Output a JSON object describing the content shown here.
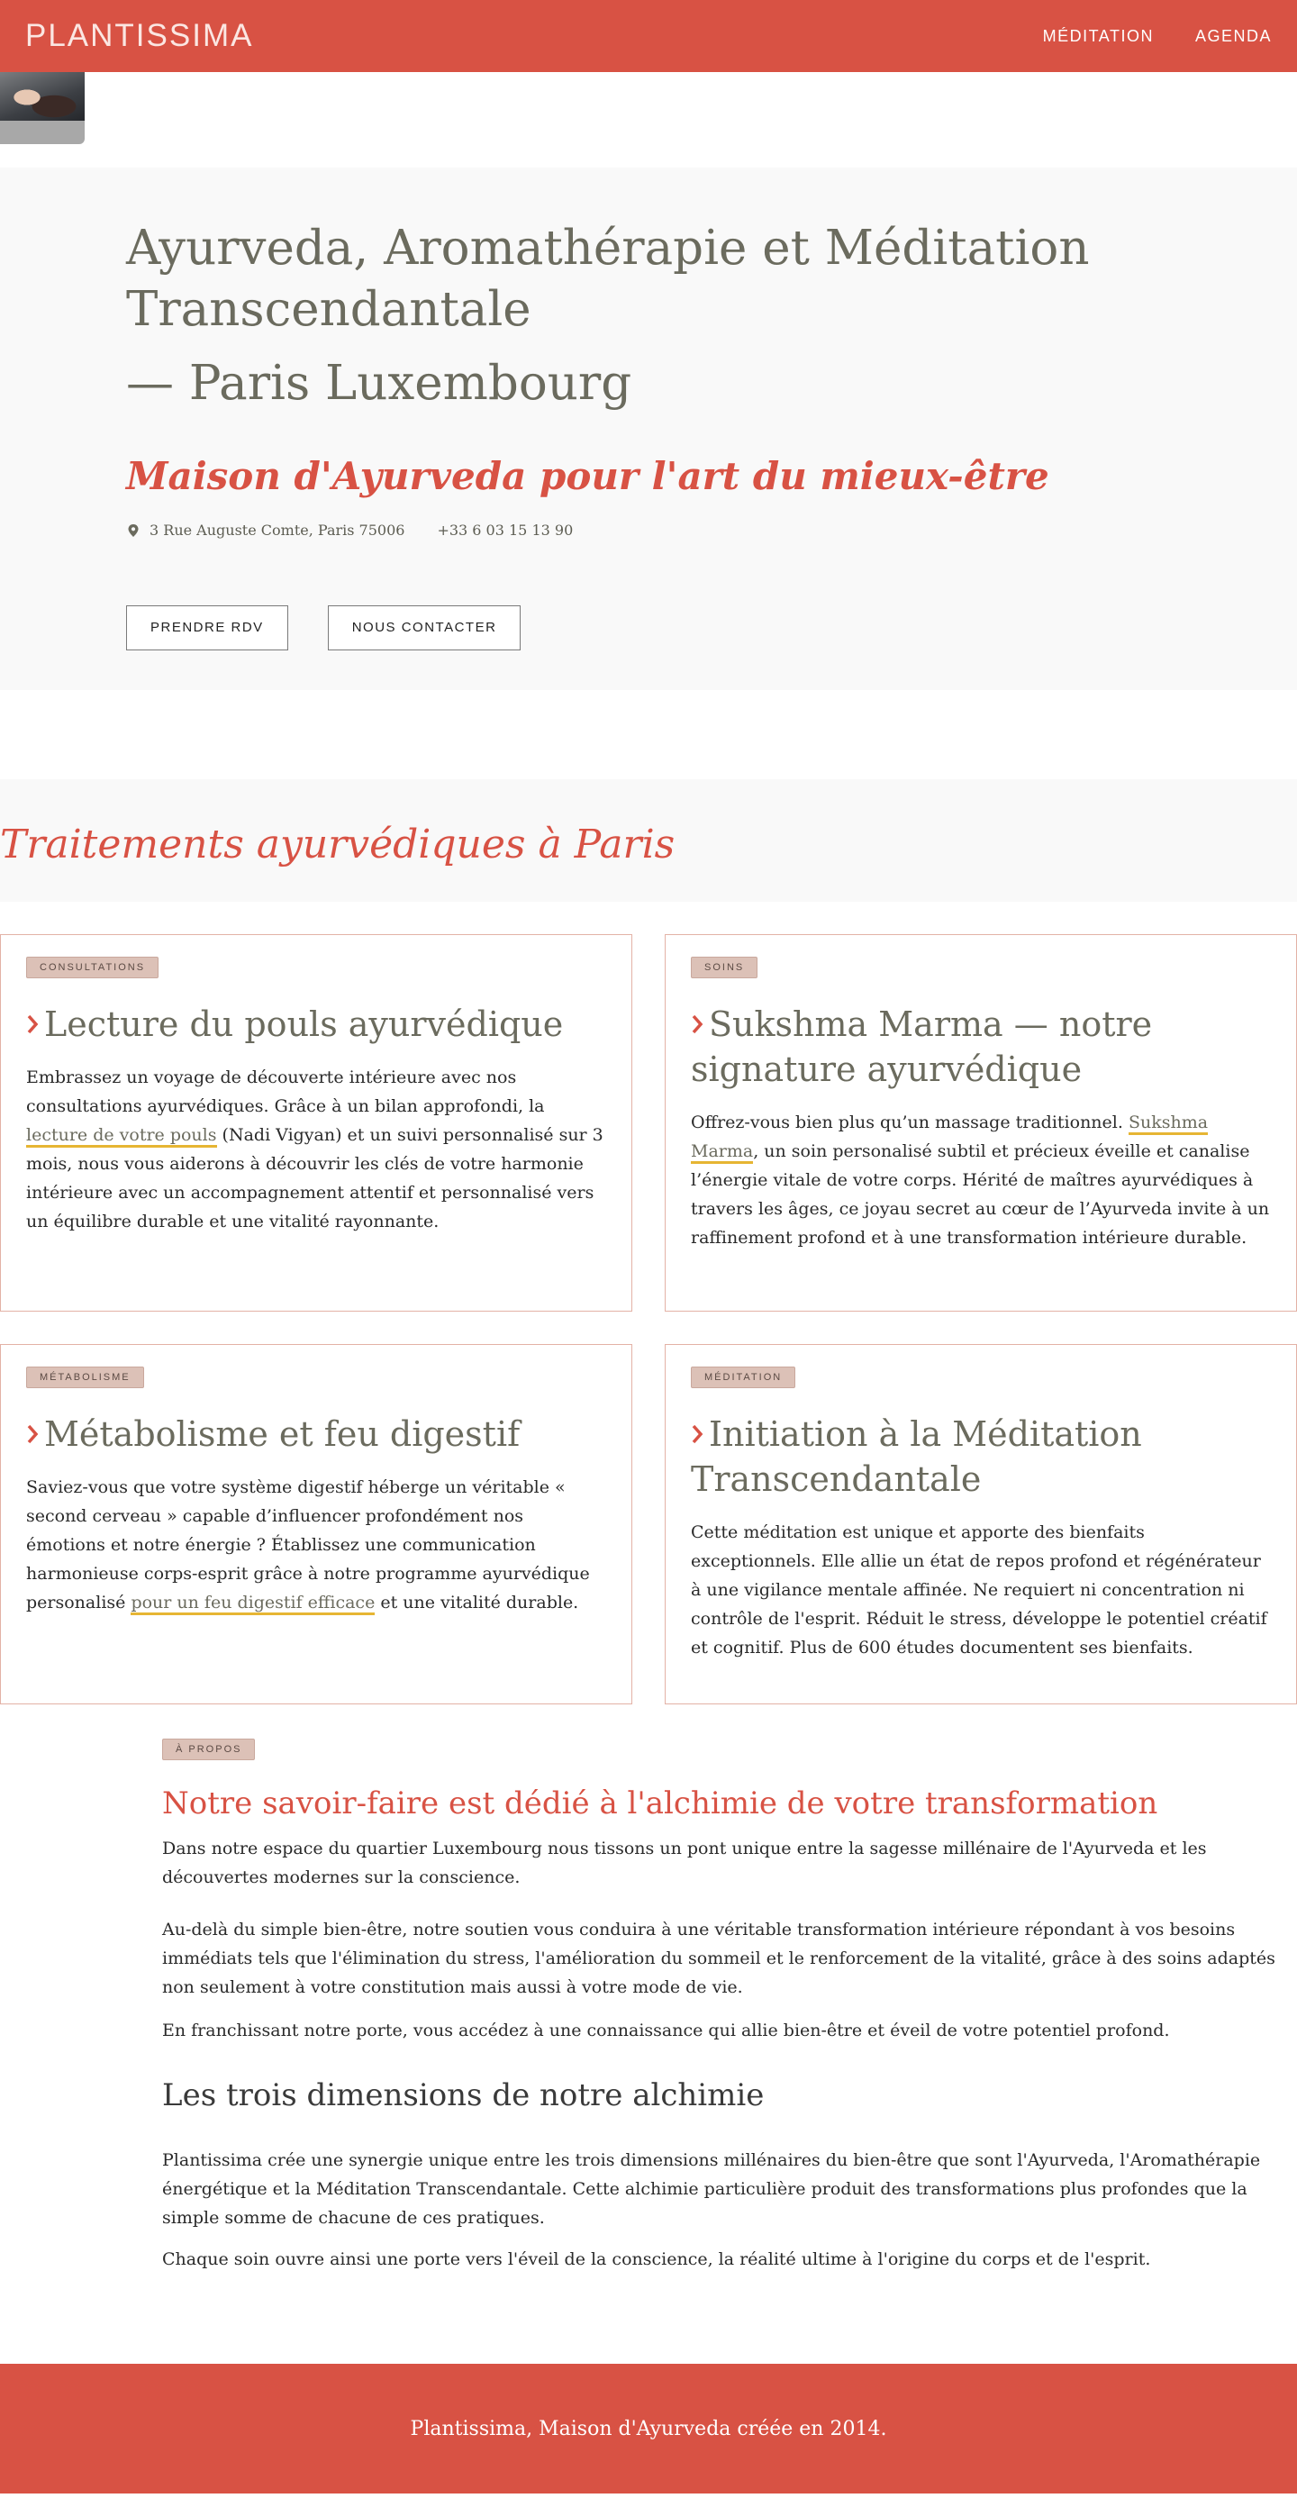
{
  "brand": {
    "logo": "PLANTISSIMA",
    "accent": "#d85244"
  },
  "nav": {
    "items": [
      "MÉDITATION",
      "AGENDA"
    ]
  },
  "hero": {
    "title": "Ayurveda, Aromathérapie et Méditation Transcendantale",
    "city": "— Paris Luxembourg",
    "subtitle": "Maison d'Ayurveda pour l'art du mieux-être",
    "address": "3 Rue Auguste Comte, Paris 75006",
    "phone": "+33 6 03 15 13 90",
    "btn_rdv": "PRENDRE RDV",
    "btn_contact": "NOUS CONTACTER"
  },
  "treatments": {
    "heading": "Traitements ayurvédiques à Paris",
    "cards": [
      {
        "tag": "CONSULTATIONS",
        "title": "Lecture du pouls ayurvédique",
        "text_before": "Embrassez un voyage de découverte intérieure avec nos consultations ayurvédiques. Grâce à un bilan approfondi, la ",
        "link": "lecture de votre pouls",
        "text_after": " (Nadi Vigyan) et un suivi personnalisé sur 3 mois, nous vous aiderons à découvrir les clés de votre harmonie intérieure avec un accompagnement attentif et personnalisé vers un équilibre durable et une vitalité rayonnante."
      },
      {
        "tag": "SOINS",
        "title": "Sukshma Marma — notre signature ayurvédique",
        "text_before": "Offrez-vous bien plus qu’un massage traditionnel. ",
        "link": "Sukshma Marma",
        "text_after": ", un soin personalisé subtil et précieux éveille et canalise l’énergie vitale de votre corps. Hérité de maîtres ayurvédiques à travers les âges, ce joyau secret au cœur de l’Ayurveda invite à un raffinement profond et à une transformation intérieure durable."
      },
      {
        "tag": "MÉTABOLISME",
        "title": "Métabolisme et feu digestif",
        "text_before": "Saviez-vous que votre système digestif héberge un véritable « second cerveau » capable d’influencer profondément nos émotions et notre énergie ? Établissez une communication harmonieuse corps-esprit grâce à notre programme ayurvédique personalisé ",
        "link": "pour un feu digestif efficace",
        "text_after": " et une vitalité durable."
      },
      {
        "tag": "MÉDITATION",
        "title": "Initiation à la Méditation Transcendantale",
        "text_before": "Cette méditation est unique et apporte des bienfaits exceptionnels. Elle allie un état de repos profond et régénérateur à une vigilance mentale affinée. Ne requiert ni concentration ni contrôle de l'esprit. Réduit le stress, développe le potentiel créatif et cognitif. Plus de 600 études documentent ses bienfaits.",
        "link": "",
        "text_after": ""
      }
    ]
  },
  "about": {
    "tag": "À PROPOS",
    "title": "Notre savoir-faire est dédié à l'alchimie de votre transformation",
    "p1": "Dans notre espace du quartier Luxembourg nous tissons un pont unique entre la sagesse millénaire de l'Ayurveda et les découvertes modernes sur la conscience.",
    "p2": "Au-delà du simple bien-être, notre soutien vous conduira à une véritable transformation intérieure répondant à vos besoins immédiats tels que l'élimination du stress, l'amélioration du sommeil et le renforcement de la vitalité, grâce à des soins adaptés non seulement à votre constitution mais aussi à votre mode de vie.",
    "p3": "En franchissant notre porte, vous accédez à une connaissance qui allie bien-être et éveil de votre potentiel profond.",
    "h3": "Les trois dimensions de notre alchimie",
    "p4": "Plantissima crée une synergie unique entre les trois dimensions millénaires du bien-être que sont l'Ayurveda, l'Aromathérapie énergétique et la Méditation Transcendantale. Cette alchimie particulière produit des transformations plus profondes que la simple somme de chacune de ces pratiques.",
    "p5": "Chaque soin ouvre ainsi une porte vers l'éveil de la conscience, la réalité ultime à l'origine du corps et de l'esprit."
  },
  "footer": {
    "text": "Plantissima, Maison d'Ayurveda créée en 2014."
  }
}
